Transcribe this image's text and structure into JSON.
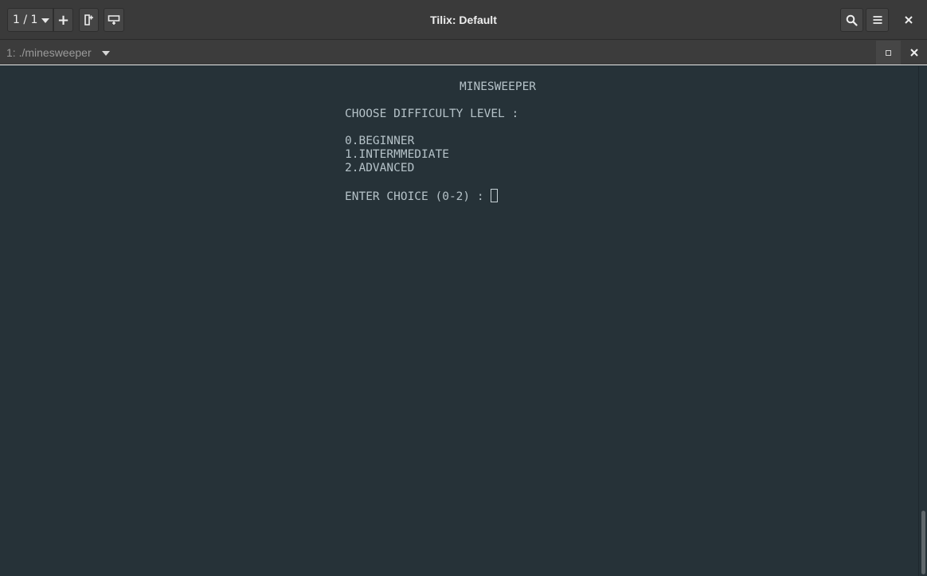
{
  "window": {
    "title": "Tilix: Default"
  },
  "header": {
    "session_label": "1 / 1",
    "add_label": "+",
    "icons": {
      "split_right": "split-right-icon",
      "split_down": "split-down-icon",
      "search": "search-icon",
      "menu": "hamburger-menu-icon",
      "close": "close-icon"
    }
  },
  "terminal_tab": {
    "title": "1: ./minesweeper"
  },
  "terminal": {
    "heading": "MINESWEEPER",
    "prompt_title": "CHOOSE DIFFICULTY LEVEL :",
    "options": [
      "0.BEGINNER",
      "1.INTERMMEDIATE",
      "2.ADVANCED"
    ],
    "input_prompt": "ENTER CHOICE (0-2) : "
  },
  "colors": {
    "terminal_bg": "#263238",
    "terminal_fg": "#b5c2c8",
    "header_bg": "#3a3a3a"
  }
}
